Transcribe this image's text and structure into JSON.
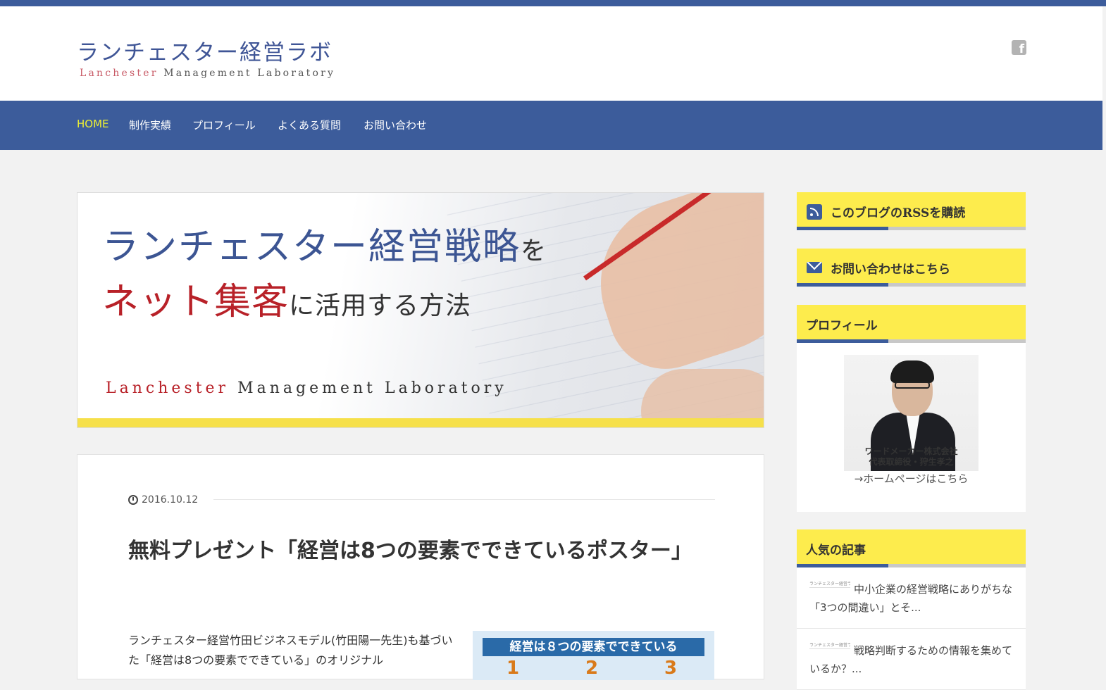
{
  "header": {
    "logo_jp": "ランチェスター経営ラボ",
    "logo_en_1": "Lanchester",
    "logo_en_2": "Management Laboratory",
    "social_icon": "facebook-icon"
  },
  "nav": {
    "items": [
      "HOME",
      "制作実績",
      "プロフィール",
      "よくある質問",
      "お問い合わせ"
    ]
  },
  "banner": {
    "line1_main": "ランチェスター経営戦略",
    "line1_small": "を",
    "line2_main": "ネット集客",
    "line2_small": "に活用する方法",
    "en_1": "Lanchester",
    "en_2": "Management Laboratory"
  },
  "post": {
    "date": "2016.10.12",
    "title": "無料プレゼント「経営は8つの要素でできているポスター」",
    "excerpt": "ランチェスター経営竹田ビジネスモデル(竹田陽一先生)も基づいた「経営は8つの要素でできている」のオリジナル",
    "poster_heading": "経営は８つの要素でできている",
    "poster_nums": [
      "1",
      "2",
      "3"
    ]
  },
  "sidebar": {
    "rss": "このブログのRSSを購読",
    "contact": "お問い合わせはこちら",
    "profile_title": "プロフィール",
    "profile_caption_1": "ワードメーカー株式会社",
    "profile_caption_2": "代表取締役・狩生孝之",
    "profile_link": "→ホームページはこちら",
    "popular_title": "人気の記事",
    "popular": [
      {
        "thumb": "ランチェスター経営ラボ",
        "text": "中小企業の経営戦略にありがちな「3つの間違い」とそ..."
      },
      {
        "thumb": "ランチェスター経営ラボ",
        "text": "戦略判断するための情報を集めているか？..."
      }
    ]
  },
  "colors": {
    "brand_blue": "#3c5c9b",
    "accent_yellow": "#fdec4d",
    "nav_active": "#eef033",
    "banner_red": "#b82128"
  }
}
